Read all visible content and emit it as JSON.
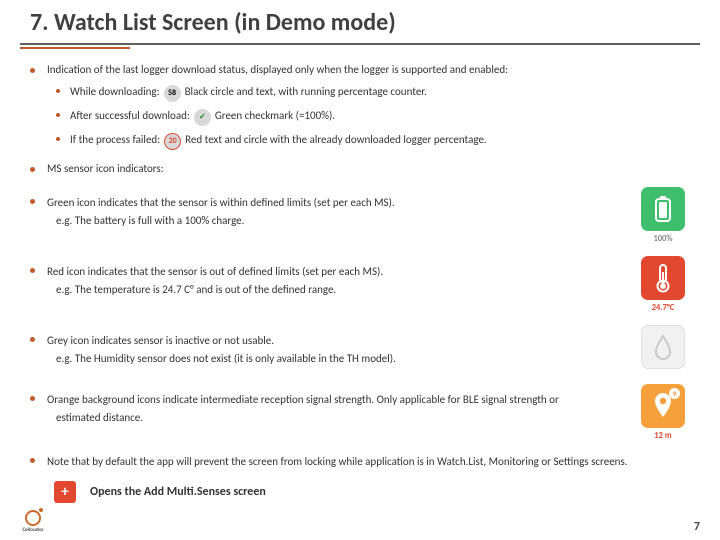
{
  "title": "7. Watch List Screen (in Demo mode)",
  "b1": {
    "lead": "Indication of the last logger download status, displayed only when the logger is supported and enabled:",
    "s1a": "While downloading:",
    "s1b": "Black circle and text, with running percentage counter.",
    "s1b_badge": "58",
    "s2a": "After successful download:",
    "s2b": "Green checkmark (=100%).",
    "s3a": "If the process failed:",
    "s3b": "Red text and circle with the already downloaded logger percentage.",
    "s3b_badge": "20"
  },
  "b2": {
    "lead": "MS sensor icon indicators:",
    "g1": "Green icon indicates that the sensor is within defined limits (set per each MS).",
    "g1e": "e.g. The battery is full with a 100% charge.",
    "r1": "Red icon indicates that the sensor is out of defined limits (set per each MS).",
    "r1e": "e.g. The temperature is 24.7 C° and is out of the defined range.",
    "gr1": "Grey icon indicates sensor is inactive or not usable.",
    "gr1e": "e.g.  The Humidity sensor does not exist (it is only available in the TH model).",
    "o1": "Orange background icons indicate intermediate reception signal strength. Only applicable for BLE signal strength or",
    "o1b": "estimated distance."
  },
  "tiles": {
    "green_label": "100%",
    "red_label": "24.7°C",
    "grey_label": "",
    "orange_label": "12 m",
    "orange_mini": "9"
  },
  "note": "Note that by default the app will prevent the screen from locking while application is in Watch.List, Monitoring or Settings screens.",
  "add_label": "Opens the Add Multi.Senses screen",
  "add_btn": "+",
  "logo_text": "Cellocator",
  "page": "7"
}
